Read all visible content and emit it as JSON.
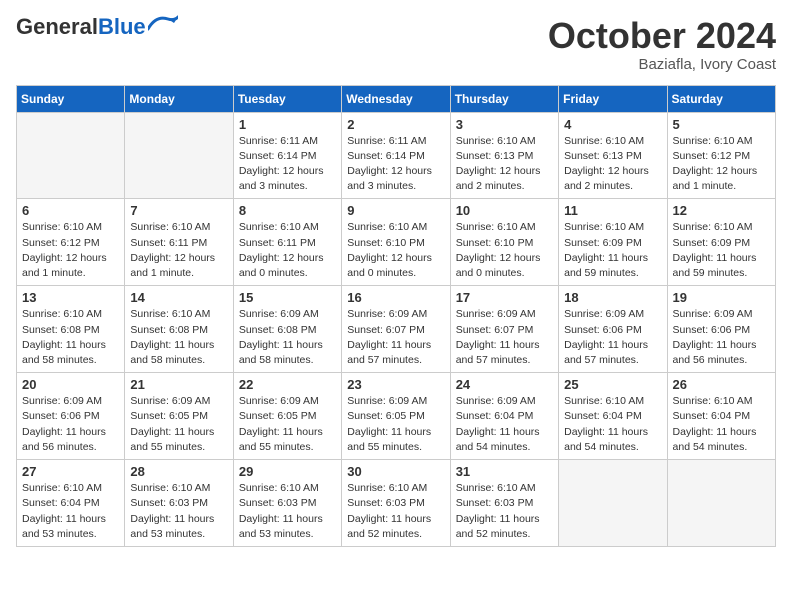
{
  "header": {
    "logo_general": "General",
    "logo_blue": "Blue",
    "month_title": "October 2024",
    "location": "Baziafla, Ivory Coast"
  },
  "weekdays": [
    "Sunday",
    "Monday",
    "Tuesday",
    "Wednesday",
    "Thursday",
    "Friday",
    "Saturday"
  ],
  "weeks": [
    [
      {
        "day": "",
        "info": ""
      },
      {
        "day": "",
        "info": ""
      },
      {
        "day": "1",
        "info": "Sunrise: 6:11 AM\nSunset: 6:14 PM\nDaylight: 12 hours and 3 minutes."
      },
      {
        "day": "2",
        "info": "Sunrise: 6:11 AM\nSunset: 6:14 PM\nDaylight: 12 hours and 3 minutes."
      },
      {
        "day": "3",
        "info": "Sunrise: 6:10 AM\nSunset: 6:13 PM\nDaylight: 12 hours and 2 minutes."
      },
      {
        "day": "4",
        "info": "Sunrise: 6:10 AM\nSunset: 6:13 PM\nDaylight: 12 hours and 2 minutes."
      },
      {
        "day": "5",
        "info": "Sunrise: 6:10 AM\nSunset: 6:12 PM\nDaylight: 12 hours and 1 minute."
      }
    ],
    [
      {
        "day": "6",
        "info": "Sunrise: 6:10 AM\nSunset: 6:12 PM\nDaylight: 12 hours and 1 minute."
      },
      {
        "day": "7",
        "info": "Sunrise: 6:10 AM\nSunset: 6:11 PM\nDaylight: 12 hours and 1 minute."
      },
      {
        "day": "8",
        "info": "Sunrise: 6:10 AM\nSunset: 6:11 PM\nDaylight: 12 hours and 0 minutes."
      },
      {
        "day": "9",
        "info": "Sunrise: 6:10 AM\nSunset: 6:10 PM\nDaylight: 12 hours and 0 minutes."
      },
      {
        "day": "10",
        "info": "Sunrise: 6:10 AM\nSunset: 6:10 PM\nDaylight: 12 hours and 0 minutes."
      },
      {
        "day": "11",
        "info": "Sunrise: 6:10 AM\nSunset: 6:09 PM\nDaylight: 11 hours and 59 minutes."
      },
      {
        "day": "12",
        "info": "Sunrise: 6:10 AM\nSunset: 6:09 PM\nDaylight: 11 hours and 59 minutes."
      }
    ],
    [
      {
        "day": "13",
        "info": "Sunrise: 6:10 AM\nSunset: 6:08 PM\nDaylight: 11 hours and 58 minutes."
      },
      {
        "day": "14",
        "info": "Sunrise: 6:10 AM\nSunset: 6:08 PM\nDaylight: 11 hours and 58 minutes."
      },
      {
        "day": "15",
        "info": "Sunrise: 6:09 AM\nSunset: 6:08 PM\nDaylight: 11 hours and 58 minutes."
      },
      {
        "day": "16",
        "info": "Sunrise: 6:09 AM\nSunset: 6:07 PM\nDaylight: 11 hours and 57 minutes."
      },
      {
        "day": "17",
        "info": "Sunrise: 6:09 AM\nSunset: 6:07 PM\nDaylight: 11 hours and 57 minutes."
      },
      {
        "day": "18",
        "info": "Sunrise: 6:09 AM\nSunset: 6:06 PM\nDaylight: 11 hours and 57 minutes."
      },
      {
        "day": "19",
        "info": "Sunrise: 6:09 AM\nSunset: 6:06 PM\nDaylight: 11 hours and 56 minutes."
      }
    ],
    [
      {
        "day": "20",
        "info": "Sunrise: 6:09 AM\nSunset: 6:06 PM\nDaylight: 11 hours and 56 minutes."
      },
      {
        "day": "21",
        "info": "Sunrise: 6:09 AM\nSunset: 6:05 PM\nDaylight: 11 hours and 55 minutes."
      },
      {
        "day": "22",
        "info": "Sunrise: 6:09 AM\nSunset: 6:05 PM\nDaylight: 11 hours and 55 minutes."
      },
      {
        "day": "23",
        "info": "Sunrise: 6:09 AM\nSunset: 6:05 PM\nDaylight: 11 hours and 55 minutes."
      },
      {
        "day": "24",
        "info": "Sunrise: 6:09 AM\nSunset: 6:04 PM\nDaylight: 11 hours and 54 minutes."
      },
      {
        "day": "25",
        "info": "Sunrise: 6:10 AM\nSunset: 6:04 PM\nDaylight: 11 hours and 54 minutes."
      },
      {
        "day": "26",
        "info": "Sunrise: 6:10 AM\nSunset: 6:04 PM\nDaylight: 11 hours and 54 minutes."
      }
    ],
    [
      {
        "day": "27",
        "info": "Sunrise: 6:10 AM\nSunset: 6:04 PM\nDaylight: 11 hours and 53 minutes."
      },
      {
        "day": "28",
        "info": "Sunrise: 6:10 AM\nSunset: 6:03 PM\nDaylight: 11 hours and 53 minutes."
      },
      {
        "day": "29",
        "info": "Sunrise: 6:10 AM\nSunset: 6:03 PM\nDaylight: 11 hours and 53 minutes."
      },
      {
        "day": "30",
        "info": "Sunrise: 6:10 AM\nSunset: 6:03 PM\nDaylight: 11 hours and 52 minutes."
      },
      {
        "day": "31",
        "info": "Sunrise: 6:10 AM\nSunset: 6:03 PM\nDaylight: 11 hours and 52 minutes."
      },
      {
        "day": "",
        "info": ""
      },
      {
        "day": "",
        "info": ""
      }
    ]
  ]
}
